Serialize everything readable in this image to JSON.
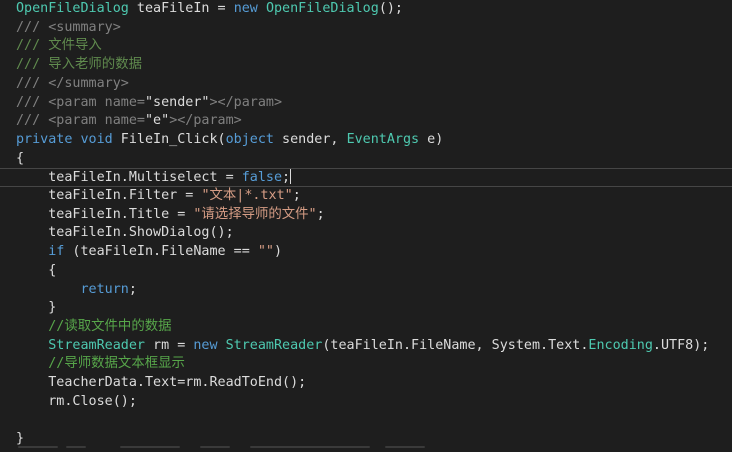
{
  "editor": {
    "line1": {
      "t1": "OpenFileDialog",
      "t2": " teaFileIn = ",
      "t3": "new",
      "t4": " ",
      "t5": "OpenFileDialog",
      "t6": "();"
    },
    "line2": {
      "t1": "/// ",
      "t2": "<summary>"
    },
    "line3": {
      "t1": "/// 文件导入"
    },
    "line4": {
      "t1": "/// 导入老师的数据"
    },
    "line5": {
      "t1": "/// ",
      "t2": "</summary>"
    },
    "line6": {
      "t1": "/// ",
      "t2": "<param name=",
      "t3": "\"sender\"",
      "t4": "></param>"
    },
    "line7": {
      "t1": "/// ",
      "t2": "<param name=",
      "t3": "\"e\"",
      "t4": "></param>"
    },
    "line8": {
      "t1": "private",
      "t2": " ",
      "t3": "void",
      "t4": " FileIn_Click(",
      "t5": "object",
      "t6": " sender, ",
      "t7": "EventArgs",
      "t8": " e)"
    },
    "line9": {
      "t1": "{"
    },
    "line10": {
      "t1": "    teaFileIn.Multiselect = ",
      "t2": "false",
      "t3": ";"
    },
    "line11": {
      "t1": "    teaFileIn.Filter = ",
      "t2": "\"文本|*.txt\"",
      "t3": ";"
    },
    "line12": {
      "t1": "    teaFileIn.Title = ",
      "t2": "\"请选择导师的文件\"",
      "t3": ";"
    },
    "line13": {
      "t1": "    teaFileIn.ShowDialog();"
    },
    "line14": {
      "t1": "    ",
      "t2": "if",
      "t3": " (teaFileIn.FileName == ",
      "t4": "\"\"",
      "t5": ")"
    },
    "line15": {
      "t1": "    {"
    },
    "line16": {
      "t1": "        ",
      "t2": "return",
      "t3": ";"
    },
    "line17": {
      "t1": "    }"
    },
    "line18": {
      "t1": "    //读取文件中的数据"
    },
    "line19": {
      "t1": "    ",
      "t2": "StreamReader",
      "t3": " rm = ",
      "t4": "new",
      "t5": " ",
      "t6": "StreamReader",
      "t7": "(teaFileIn.FileName, System.Text.",
      "t8": "Encoding",
      "t9": ".UTF8);"
    },
    "line20": {
      "t1": "    //导师数据文本框显示"
    },
    "line21": {
      "t1": "    TeacherData.Text=rm.ReadToEnd();"
    },
    "line22": {
      "t1": "    rm.Close();"
    },
    "line23": {
      "t1": ""
    },
    "line24": {
      "t1": "}"
    }
  },
  "colors": {
    "background": "#1e1e1e",
    "keyword": "#569cd6",
    "type": "#4ec9b0",
    "string": "#d69d85",
    "comment": "#57a64a",
    "doc_comment": "#608b4e",
    "doc_tag": "#808080",
    "identifier": "#dcdcdc"
  }
}
